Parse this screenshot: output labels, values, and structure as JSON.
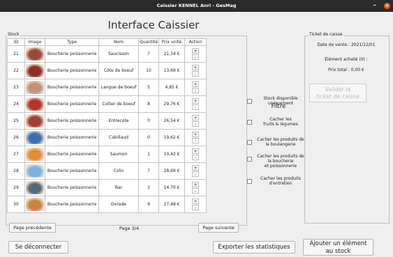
{
  "window": {
    "title": "Caissier KENNEL Anri - GesMag",
    "minimize": "–",
    "close": "×"
  },
  "main_title": "Interface Caissier",
  "stock": {
    "legend": "Stock",
    "columns": [
      "ID",
      "Image",
      "Type",
      "Nom",
      "Quantité",
      "Prix unité",
      "Action"
    ],
    "plus": "+",
    "minus": "-",
    "rows": [
      {
        "id": "21",
        "type": "Boucherie poissonnerie",
        "nom": "Saucisson",
        "quantite": "7",
        "prix": "21,34 €",
        "image": "saucisson-image"
      },
      {
        "id": "22",
        "type": "Boucherie poissonnerie",
        "nom": "Côte de boeuf",
        "quantite": "10",
        "prix": "13,69 €",
        "image": "cote-de-boeuf-image"
      },
      {
        "id": "23",
        "type": "Boucherie poissonnerie",
        "nom": "Langue de boeuf",
        "quantite": "5",
        "prix": "4,85 €",
        "image": "langue-de-boeuf-image"
      },
      {
        "id": "24",
        "type": "Boucherie poissonnerie",
        "nom": "Collier de boeuf",
        "quantite": "8",
        "prix": "29,76 €",
        "image": "collier-de-boeuf-image"
      },
      {
        "id": "25",
        "type": "Boucherie poissonnerie",
        "nom": "Entrecote",
        "quantite": "0",
        "prix": "26,54 €",
        "image": "entrecote-image"
      },
      {
        "id": "26",
        "type": "Boucherie poissonnerie",
        "nom": "Cabillaud",
        "quantite": "0",
        "prix": "19,62 €",
        "image": "cabillaud-image"
      },
      {
        "id": "27",
        "type": "Boucherie poissonnerie",
        "nom": "Saumon",
        "quantite": "1",
        "prix": "10,42 €",
        "image": "saumon-image"
      },
      {
        "id": "28",
        "type": "Boucherie poissonnerie",
        "nom": "Colin",
        "quantite": "7",
        "prix": "28,69 €",
        "image": "colin-image"
      },
      {
        "id": "29",
        "type": "Boucherie poissonnerie",
        "nom": "Bar",
        "quantite": "3",
        "prix": "14,70 €",
        "image": "bar-image"
      },
      {
        "id": "30",
        "type": "Boucherie poissonnerie",
        "nom": "Dorade",
        "quantite": "9",
        "prix": "27,48 €",
        "image": "dorade-image"
      }
    ],
    "image_colors": [
      "#9a4a3c",
      "#8b2f2a",
      "#c98d7c",
      "#b2362e",
      "#a04038",
      "#3d6fb0",
      "#e58a3a",
      "#7fb1de",
      "#5b6a72",
      "#c9843e"
    ]
  },
  "pagination": {
    "prev": "Page précédente",
    "page": "Page 3/4",
    "next": "Page suivante"
  },
  "filtre": {
    "title": "Filtre",
    "options": [
      {
        "label": "Stock disponible\nuniquement"
      },
      {
        "label": "Cacher les\nfruits & légumes"
      },
      {
        "label": "Cacher les produits de\nla boulangerie"
      },
      {
        "label": "Cacher les produits de\nla boucherie\net poissonnerie"
      },
      {
        "label": "Cacher les produits\nd'entretien"
      }
    ]
  },
  "ticket": {
    "legend": "Ticket de caisse",
    "date": "Date de vente : 2021/12/01",
    "element": "Élément acheté (0) :",
    "total": "Prix total : 0,00 €",
    "validate": "Valider le\nticket de caisse"
  },
  "footer": {
    "logout": "Se déconnecter",
    "export": "Exporter les statistiques",
    "add": "Ajouter un élément\nau stock"
  }
}
